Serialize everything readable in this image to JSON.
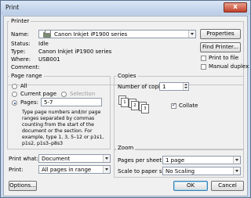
{
  "window": {
    "title": "Print",
    "close_glyph": "x"
  },
  "printer": {
    "group_label": "Printer",
    "name_label": "Name:",
    "name_value": "Canon Inkjet iP1900 series",
    "status_label": "Status:",
    "status_value": "Idle",
    "type_label": "Type:",
    "type_value": "Canon Inkjet iP1900 series",
    "where_label": "Where:",
    "where_value": "USB001",
    "comment_label": "Comment:",
    "properties_button": "Properties",
    "find_printer_button": "Find Printer...",
    "print_to_file": {
      "label": "Print to file",
      "checked": false
    },
    "manual_duplex": {
      "label": "Manual duplex",
      "checked": false
    }
  },
  "page_range": {
    "group_label": "Page range",
    "all_label": "All",
    "current_page_label": "Current page",
    "selection_label": "Selection",
    "pages_label": "Pages:",
    "pages_value": "5-7",
    "selected": "pages",
    "help_text": "Type page numbers and/or page ranges separated by commas counting from the start of the document or the section. For example, type 1, 3, 5–12 or p1s1, p1s2, p1s3–p8s3"
  },
  "copies": {
    "group_label": "Copies",
    "number_label": "Number of copies:",
    "number_value": "1",
    "collate_label": "Collate",
    "collate_checked": true,
    "page_icons": [
      "1",
      "1",
      "2",
      "2",
      "3",
      "3"
    ]
  },
  "print_what": {
    "label": "Print what:",
    "value": "Document"
  },
  "print": {
    "label": "Print:",
    "value": "All pages in range"
  },
  "zoom": {
    "group_label": "Zoom",
    "pages_per_sheet_label": "Pages per sheet:",
    "pages_per_sheet_value": "1 page",
    "scale_label": "Scale to paper size:",
    "scale_value": "No Scaling"
  },
  "footer": {
    "options_button": "Options...",
    "ok_button": "OK",
    "cancel_button": "Cancel"
  }
}
